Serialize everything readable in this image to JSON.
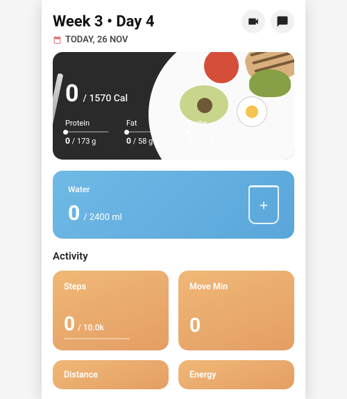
{
  "header": {
    "title": "Week 3 • Day 4",
    "date_label": "TODAY, 26 NOV"
  },
  "nutrition": {
    "calories_value": "0",
    "calories_goal": "/ 1570 Cal",
    "macros": [
      {
        "label": "Protein",
        "value": "0",
        "goal": " / 173 g"
      },
      {
        "label": "Fat",
        "value": "0",
        "goal": " / 58 g"
      },
      {
        "label": "Carbs",
        "value": "0",
        "goal": " / 91 g"
      }
    ]
  },
  "water": {
    "label": "Water",
    "value": "0",
    "goal": "/ 2400 ml"
  },
  "activity": {
    "section_title": "Activity",
    "cards": [
      {
        "label": "Steps",
        "value": "0",
        "goal": "/ 10.0k"
      },
      {
        "label": "Move Min",
        "value": "0",
        "goal": ""
      },
      {
        "label": "Distance",
        "value": "",
        "goal": ""
      },
      {
        "label": "Energy",
        "value": "",
        "goal": ""
      }
    ]
  }
}
